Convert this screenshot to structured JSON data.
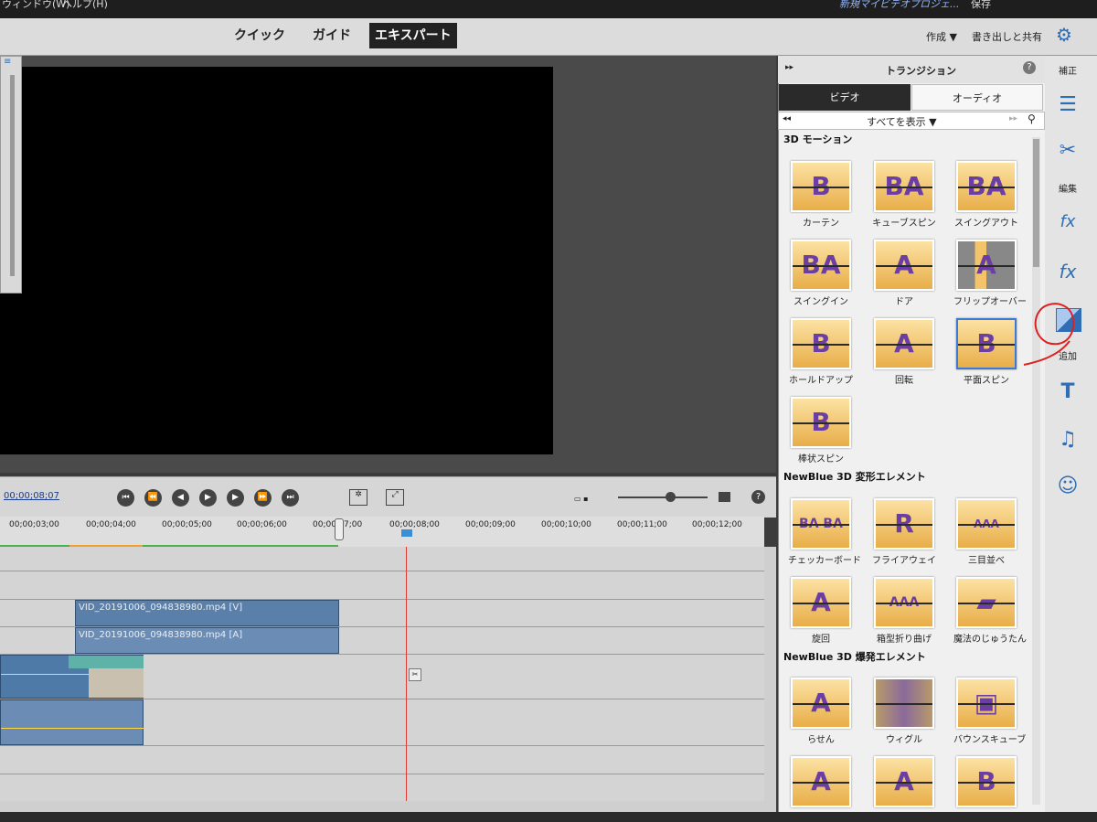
{
  "menubar": {
    "left_items": [
      "ウィンドウ(W)",
      "ヘルプ(H)"
    ],
    "project": "新規マイビデオプロジェ...",
    "save": "保存"
  },
  "modes": {
    "quick": "クイック",
    "guide": "ガイド",
    "expert": "エキスパート"
  },
  "topright": {
    "create": "作成 ▼",
    "share": "書き出しと共有"
  },
  "timecode": "00;00;08;07",
  "ruler_ticks": [
    "00;00;03;00",
    "00;00;04;00",
    "00;00;05;00",
    "00;00;06;00",
    "00;00;0",
    "7;00",
    "00;00;08;00",
    "00;00;09;00",
    "00;00;10;00",
    "00;00;11;00",
    "00;00;12;00"
  ],
  "clips": {
    "video": "VID_20191006_094838980.mp4 [V]",
    "audio": "VID_20191006_094838980.mp4 [A]"
  },
  "panel": {
    "title": "トランジション",
    "tab_video": "ビデオ",
    "tab_audio": "オーディオ",
    "filter": "すべてを表示",
    "sections": [
      {
        "name": "3D モーション",
        "items": [
          "カーテン",
          "キューブスピン",
          "スイングアウト",
          "スイングイン",
          "ドア",
          "フリップオーバー",
          "ホールドアップ",
          "回転",
          "平面スピン",
          "棒状スピン"
        ]
      },
      {
        "name": "NewBlue 3D 変形エレメント",
        "items": [
          "チェッカーボード",
          "フライアウェイ",
          "三目並べ",
          "旋回",
          "箱型折り曲げ",
          "魔法のじゅうたん"
        ]
      },
      {
        "name": "NewBlue 3D 爆発エレメント",
        "items": [
          "らせん",
          "ウィグル",
          "バウンスキューブ"
        ]
      }
    ]
  },
  "sidebar": {
    "correct": "補正",
    "edit": "編集",
    "add": "追加"
  }
}
